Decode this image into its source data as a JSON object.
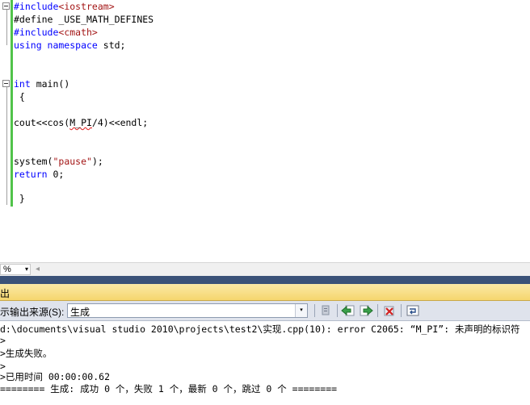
{
  "editor": {
    "lines": [
      {
        "pre": "",
        "kw": "#include",
        "mid": "",
        "hdr": "<iostream>",
        "post": ""
      },
      {
        "pre": "",
        "kw": "",
        "mid": "#define _USE_MATH_DEFINES",
        "hdr": "",
        "post": ""
      },
      {
        "pre": "",
        "kw": "#include",
        "mid": "",
        "hdr": "<cmath>",
        "post": ""
      },
      {
        "pre": "",
        "kw": "using namespace",
        "mid": " std;",
        "hdr": "",
        "post": ""
      }
    ],
    "main_sig_kw": "int",
    "main_sig_rest": " main()",
    "open_brace": " {",
    "cout_before": "cout<<cos(",
    "cout_err": "M_PI",
    "cout_after": "/4)<<endl;",
    "system_before": "system(",
    "system_str": "\"pause\"",
    "system_after": ");",
    "return_kw": "return",
    "return_rest": " 0;",
    "close_brace": " }"
  },
  "footer": {
    "zoom": "%",
    "zoom_arrow": "▾",
    "scroll_left": "◂"
  },
  "output": {
    "title": "出",
    "source_label": "示输出来源(S):",
    "source_value": "生成",
    "dropdown_arrow": "▾",
    "lines": [
      "d:\\documents\\visual studio 2010\\projects\\test2\\实现.cpp(10): error C2065: “M_PI”: 未声明的标识符",
      ">",
      ">生成失败。",
      ">",
      ">已用时间 00:00:00.62",
      "======== 生成: 成功 0 个，失败 1 个，最新 0 个，跳过 0 个 ========"
    ]
  },
  "colors": {
    "gutter_green": "#51c34a",
    "keyword_blue": "#0000ff",
    "string_red": "#a31515",
    "output_title_gold": "#f5d66e"
  }
}
